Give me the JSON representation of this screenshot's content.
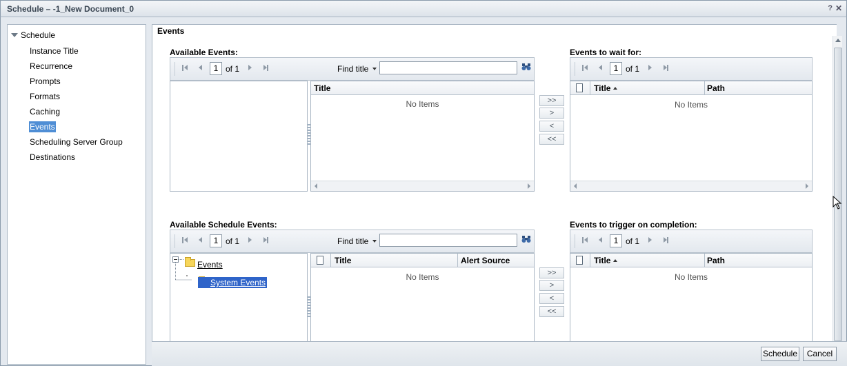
{
  "window": {
    "title": "Schedule – -1_New Document_0",
    "help_label": "?",
    "close_label": "✕"
  },
  "nav": {
    "root": "Schedule",
    "items": [
      {
        "label": "Instance Title",
        "selected": false
      },
      {
        "label": "Recurrence",
        "selected": false
      },
      {
        "label": "Prompts",
        "selected": false
      },
      {
        "label": "Formats",
        "selected": false
      },
      {
        "label": "Caching",
        "selected": false
      },
      {
        "label": "Events",
        "selected": true
      },
      {
        "label": "Scheduling Server Group",
        "selected": false
      },
      {
        "label": "Destinations",
        "selected": false
      }
    ]
  },
  "main": {
    "heading": "Events",
    "available_events": {
      "label": "Available Events:",
      "page": "1",
      "of_label": "of 1",
      "find_label": "Find title",
      "find_value": "",
      "columns": [
        "Title"
      ],
      "empty_text": "No Items"
    },
    "wait_events": {
      "label": "Events to wait for:",
      "page": "1",
      "of_label": "of 1",
      "columns": [
        "Title",
        "Path"
      ],
      "empty_text": "No Items"
    },
    "available_schedule_events": {
      "label": "Available Schedule Events:",
      "page": "1",
      "of_label": "of 1",
      "find_label": "Find title",
      "find_value": "",
      "columns": [
        "Title",
        "Alert Source"
      ],
      "empty_text": "No Items",
      "tree": {
        "root": "Events",
        "child": "System Events"
      }
    },
    "trigger_events": {
      "label": "Events to trigger on completion:",
      "page": "1",
      "of_label": "of 1",
      "columns": [
        "Title",
        "Path"
      ],
      "empty_text": "No Items"
    },
    "move_buttons": {
      "add_all": ">>",
      "add": ">",
      "remove": "<",
      "remove_all": "<<"
    }
  },
  "footer": {
    "schedule_label": "Schedule",
    "cancel_label": "Cancel"
  },
  "colors": {
    "selection": "#4f8ed5",
    "folder": "#f7d65a",
    "border": "#a9b6c3"
  }
}
